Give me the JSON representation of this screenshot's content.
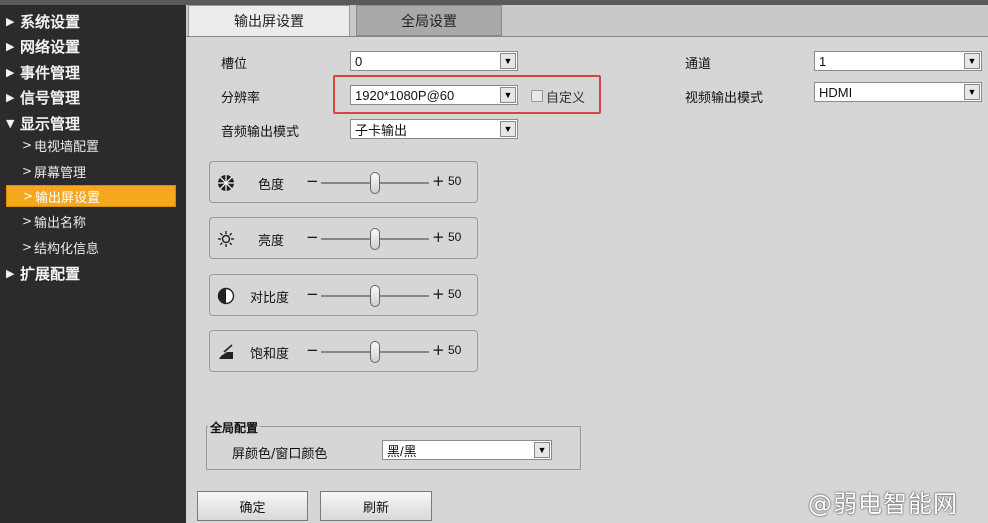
{
  "sidebar": {
    "groups": [
      {
        "label": "系统设置",
        "arrow": "▶"
      },
      {
        "label": "网络设置",
        "arrow": "▶"
      },
      {
        "label": "事件管理",
        "arrow": "▶"
      },
      {
        "label": "信号管理",
        "arrow": "▶"
      },
      {
        "label": "显示管理",
        "arrow": "▼"
      },
      {
        "label": "扩展配置",
        "arrow": "▶"
      }
    ],
    "display_sub": [
      {
        "label": "电视墙配置"
      },
      {
        "label": "屏幕管理"
      },
      {
        "label": "输出屏设置",
        "active": true
      },
      {
        "label": "输出名称"
      },
      {
        "label": "结构化信息"
      }
    ],
    "sub_chevron": ">"
  },
  "tabs": {
    "active": "输出屏设置",
    "inactive": "全局设置"
  },
  "form": {
    "slot_label": "槽位",
    "slot_value": "0",
    "resolution_label": "分辨率",
    "resolution_value": "1920*1080P@60",
    "custom_label": "自定义",
    "audio_label": "音频输出模式",
    "audio_value": "子卡输出",
    "channel_label": "通道",
    "channel_value": "1",
    "video_out_label": "视频输出模式",
    "video_out_value": "HDMI"
  },
  "sliders": [
    {
      "label": "色度",
      "value": "50",
      "icon": "hue-icon",
      "level": 0.5
    },
    {
      "label": "亮度",
      "value": "50",
      "icon": "brightness-icon",
      "level": 0.5
    },
    {
      "label": "对比度",
      "value": "50",
      "icon": "contrast-icon",
      "level": 0.5
    },
    {
      "label": "饱和度",
      "value": "50",
      "icon": "saturation-icon",
      "level": 0.5
    }
  ],
  "slider_minus": "−",
  "slider_plus": "+",
  "global": {
    "legend": "全局配置",
    "color_label": "屏颜色/窗口颜色",
    "color_value": "黑/黑"
  },
  "buttons": {
    "ok": "确定",
    "refresh": "刷新"
  },
  "watermark": "@弱电智能网",
  "colors": {
    "active_item": "#f5a81e",
    "highlight_border": "#d6453f"
  }
}
